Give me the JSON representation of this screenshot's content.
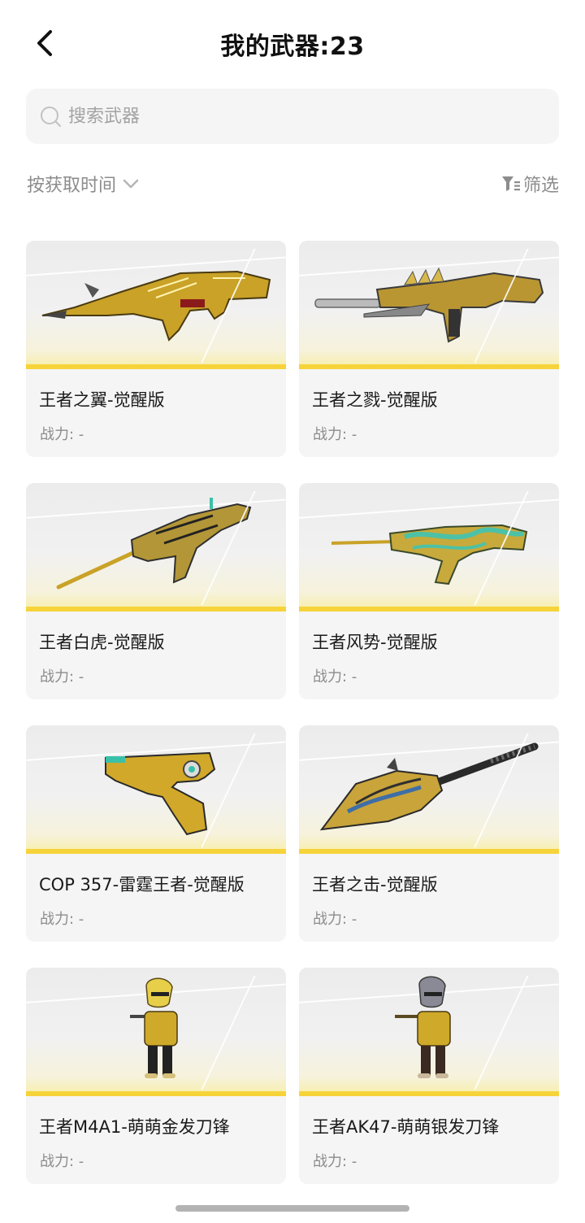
{
  "header": {
    "title": "我的武器:23"
  },
  "search": {
    "placeholder": "搜索武器"
  },
  "sort": {
    "label": "按获取时间"
  },
  "filter": {
    "label": "筛选"
  },
  "colors": {
    "accent": "#f7d33a",
    "card_bg": "#f5f5f5",
    "muted_text": "#8c8c8c"
  },
  "items": [
    {
      "name": "王者之翼-觉醒版",
      "power": "战力: -",
      "kind": "rifle-ak"
    },
    {
      "name": "王者之戮-觉醒版",
      "power": "战力: -",
      "kind": "rifle-m4"
    },
    {
      "name": "王者白虎-觉醒版",
      "power": "战力: -",
      "kind": "rifle-sniper"
    },
    {
      "name": "王者风势-觉醒版",
      "power": "战力: -",
      "kind": "rifle-jade"
    },
    {
      "name": "COP 357-雷霆王者-觉醒版",
      "power": "战力: -",
      "kind": "pistol"
    },
    {
      "name": "王者之击-觉醒版",
      "power": "战力: -",
      "kind": "shovel"
    },
    {
      "name": "王者M4A1-萌萌金发刀锋",
      "power": "战力: -",
      "kind": "chibi-gold"
    },
    {
      "name": "王者AK47-萌萌银发刀锋",
      "power": "战力: -",
      "kind": "chibi-silver"
    }
  ]
}
